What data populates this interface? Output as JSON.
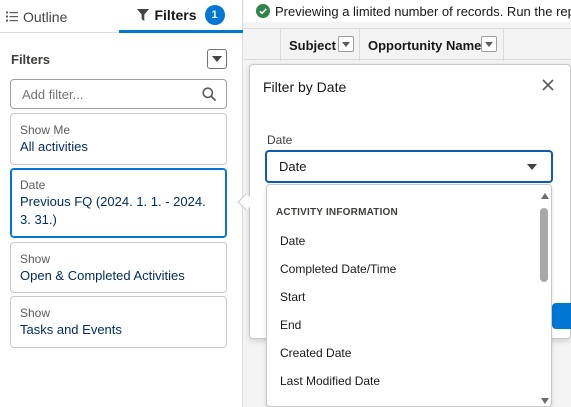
{
  "tabs": {
    "outline_label": "Outline",
    "filters_label": "Filters",
    "filters_count": "1"
  },
  "filters_panel": {
    "heading": "Filters",
    "add_filter_placeholder": "Add filter...",
    "cards": [
      {
        "label": "Show Me",
        "value": "All activities"
      },
      {
        "label": "Date",
        "value": "Previous FQ (2024. 1. 1. - 2024. 3. 31.)"
      },
      {
        "label": "Show",
        "value": "Open & Completed Activities"
      },
      {
        "label": "Show",
        "value": "Tasks and Events"
      }
    ]
  },
  "notice": {
    "text": "Previewing a limited number of records. Run the report t"
  },
  "grid": {
    "columns": [
      "Subject",
      "Opportunity Name"
    ]
  },
  "dialog": {
    "title": "Filter by Date",
    "field_label": "Date",
    "selected_value": "Date"
  },
  "dropdown": {
    "group_label": "ACTIVITY INFORMATION",
    "options": [
      "Date",
      "Completed Date/Time",
      "Start",
      "End",
      "Created Date",
      "Last Modified Date"
    ]
  },
  "colors": {
    "brand_blue": "#0176d3",
    "success_green": "#2e844a"
  }
}
